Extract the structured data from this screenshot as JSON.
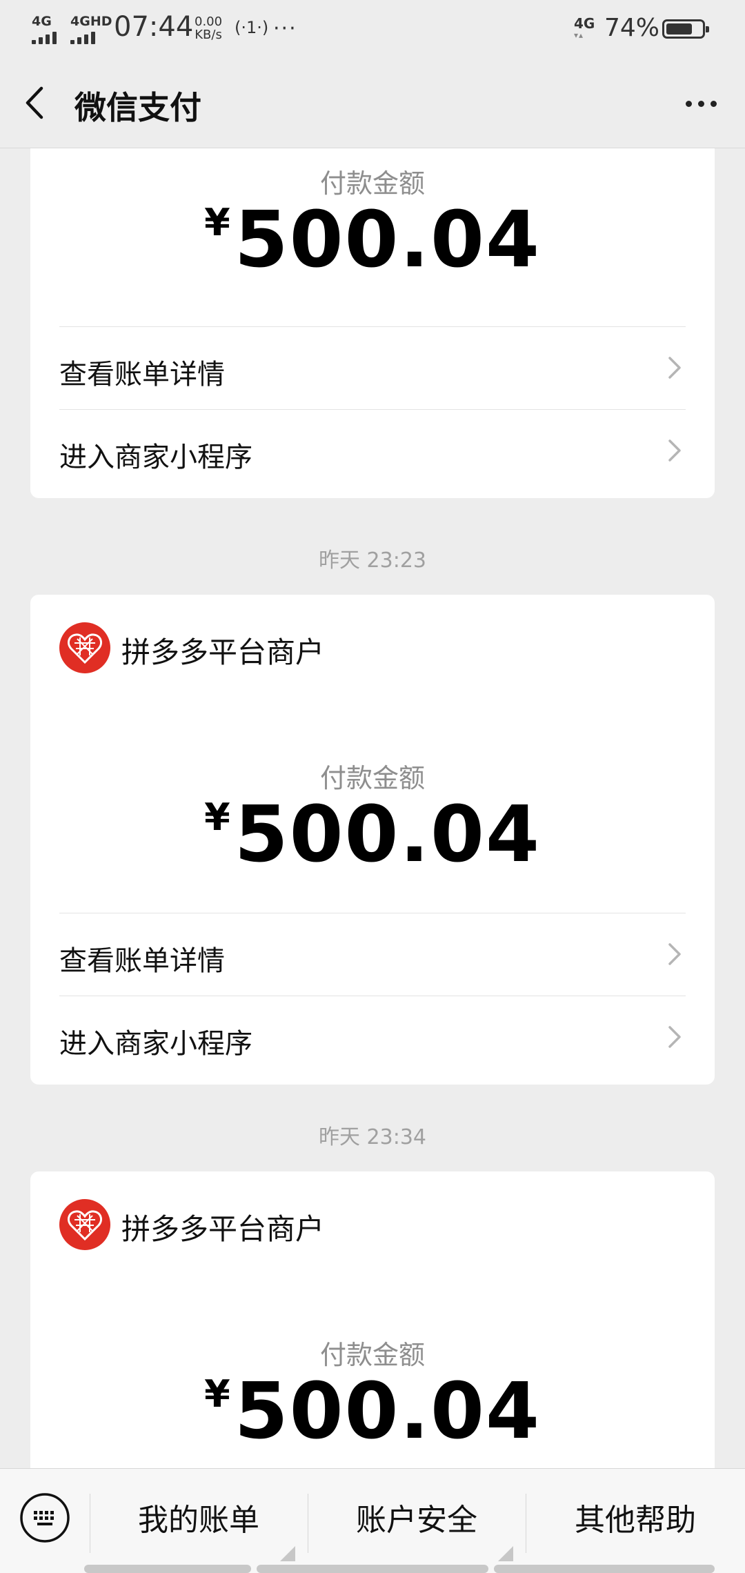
{
  "status_bar": {
    "net1": "4G",
    "net2": "4GHD",
    "time": "07:44",
    "speed_value": "0.00",
    "speed_unit": "KB/s",
    "hotspot": "(·1·)",
    "more": "···",
    "net_right": "4G",
    "battery_pct": "74%",
    "battery_level": 0.74
  },
  "nav": {
    "title": "微信支付",
    "back_icon": "chevron-left-icon",
    "more_icon": "more-dots-icon"
  },
  "cards": [
    {
      "amount_label": "付款金额",
      "currency": "¥",
      "amount": "500.04",
      "row1": "查看账单详情",
      "row2": "进入商家小程序"
    },
    {
      "merchant": "拼多多平台商户",
      "amount_label": "付款金额",
      "currency": "¥",
      "amount": "500.04",
      "row1": "查看账单详情",
      "row2": "进入商家小程序"
    },
    {
      "merchant": "拼多多平台商户",
      "amount_label": "付款金额",
      "currency": "¥",
      "amount": "500.04"
    }
  ],
  "timestamps": [
    "昨天 23:23",
    "昨天 23:34"
  ],
  "bottom_bar": {
    "keyboard_icon": "keyboard-icon",
    "tabs": [
      {
        "label": "我的账单"
      },
      {
        "label": "账户安全"
      },
      {
        "label": "其他帮助"
      }
    ]
  },
  "colors": {
    "background": "#ededed",
    "card": "#ffffff",
    "merchant_logo": "#e02e24",
    "muted_text": "#8e8e8e"
  }
}
